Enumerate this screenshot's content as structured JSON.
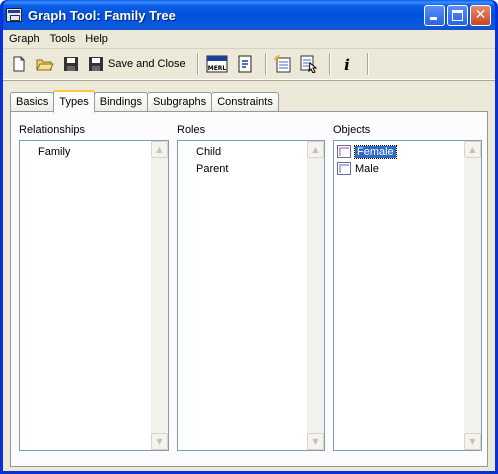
{
  "window": {
    "title": "Graph Tool: Family Tree"
  },
  "menu": [
    "Graph",
    "Tools",
    "Help"
  ],
  "toolbar": {
    "save_and_close_label": "Save and Close",
    "merl_label": "MERL",
    "info_label": "i"
  },
  "tabs": [
    {
      "label": "Basics",
      "active": false
    },
    {
      "label": "Types",
      "active": true
    },
    {
      "label": "Bindings",
      "active": false
    },
    {
      "label": "Subgraphs",
      "active": false
    },
    {
      "label": "Constraints",
      "active": false
    }
  ],
  "panels": {
    "relationships": {
      "label": "Relationships",
      "items": [
        "Family"
      ]
    },
    "roles": {
      "label": "Roles",
      "items": [
        "Child",
        "Parent"
      ]
    },
    "objects": {
      "label": "Objects",
      "items": [
        "Female",
        "Male"
      ],
      "selected": "Female"
    }
  },
  "colors": {
    "titlebar": "#0052d9",
    "face": "#ece9d8",
    "selection": "#316ac5",
    "active_tab_accent": "#ffc83c"
  }
}
